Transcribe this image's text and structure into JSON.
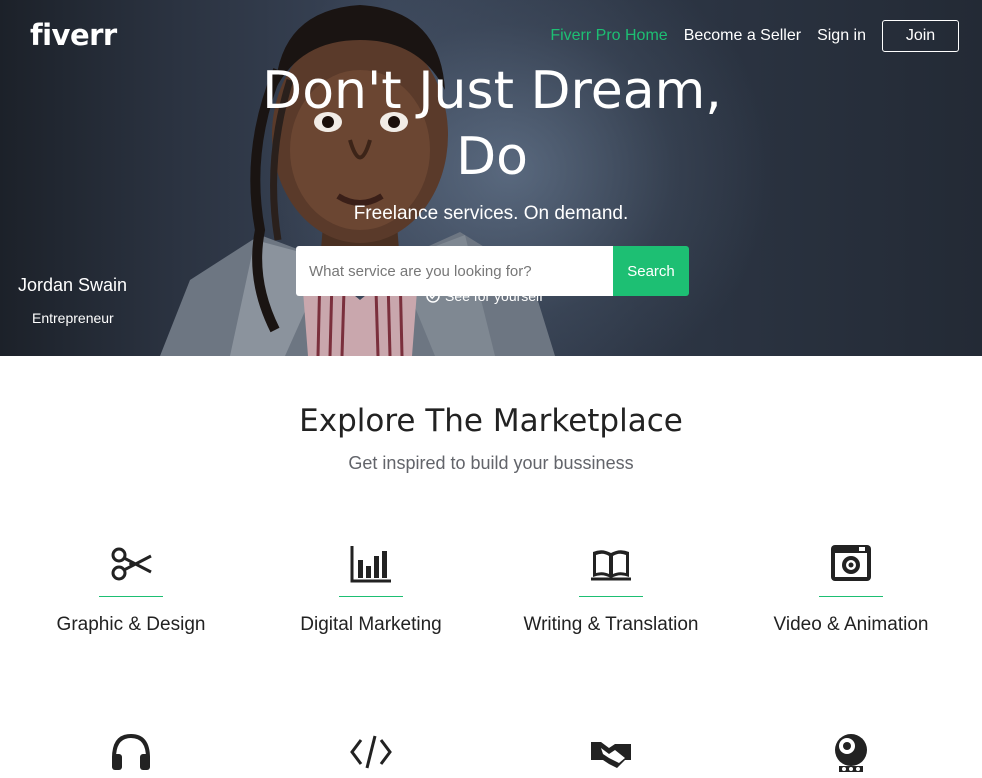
{
  "header": {
    "logo": "fiverr",
    "nav": {
      "pro_home": "Fiverr Pro Home",
      "become_seller": "Become a Seller",
      "sign_in": "Sign in",
      "join": "Join"
    }
  },
  "hero": {
    "headline_line1": "Don't Just Dream,",
    "headline_line2": "Do",
    "subhead": "Freelance services. On demand.",
    "search": {
      "placeholder": "What service are you looking for?",
      "button": "Search"
    },
    "see_link": "See for yourself",
    "caption": {
      "name": "Jordan Swain",
      "role": "Entrepreneur"
    }
  },
  "marketplace": {
    "title": "Explore The Marketplace",
    "subtitle": "Get inspired to build your bussiness",
    "categories": [
      {
        "label": "Graphic & Design",
        "icon": "scissors-icon"
      },
      {
        "label": "Digital Marketing",
        "icon": "bar-chart-icon"
      },
      {
        "label": "Writing & Translation",
        "icon": "open-book-icon"
      },
      {
        "label": "Video & Animation",
        "icon": "camera-icon"
      },
      {
        "label": "",
        "icon": "headphones-icon"
      },
      {
        "label": "",
        "icon": "code-icon"
      },
      {
        "label": "",
        "icon": "handshake-icon"
      },
      {
        "label": "",
        "icon": "mascot-icon"
      }
    ]
  },
  "colors": {
    "brand_green": "#1dbf73"
  }
}
